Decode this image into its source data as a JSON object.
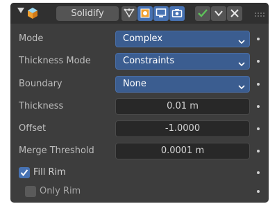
{
  "modifier": {
    "name": "Solidify",
    "icons": {
      "collapse": "collapse-triangle-icon",
      "type": "solidify-modifier-icon",
      "toggles": [
        "on-cage-icon",
        "edit-mode-icon",
        "viewport-icon",
        "render-icon"
      ],
      "apply": "checkmark-icon",
      "menu": "chevron-down-icon",
      "remove": "close-icon",
      "grip": "drag-grip-icon"
    }
  },
  "fields": {
    "mode": {
      "label": "Mode",
      "value": "Complex"
    },
    "thickness_mode": {
      "label": "Thickness Mode",
      "value": "Constraints"
    },
    "boundary": {
      "label": "Boundary",
      "value": "None"
    },
    "thickness": {
      "label": "Thickness",
      "value": "0.01 m"
    },
    "offset": {
      "label": "Offset",
      "value": "-1.0000"
    },
    "merge_threshold": {
      "label": "Merge Threshold",
      "value": "0.0001 m"
    }
  },
  "checkboxes": {
    "fill_rim": {
      "label": "Fill Rim",
      "checked": true
    },
    "only_rim": {
      "label": "Only Rim",
      "checked": false
    }
  },
  "colors": {
    "accent": "#4772b3",
    "select_bg": "#3b5d90",
    "panel_bg": "#3d3d3d",
    "header_bg": "#303030",
    "apply_green": "#5ec25a"
  }
}
